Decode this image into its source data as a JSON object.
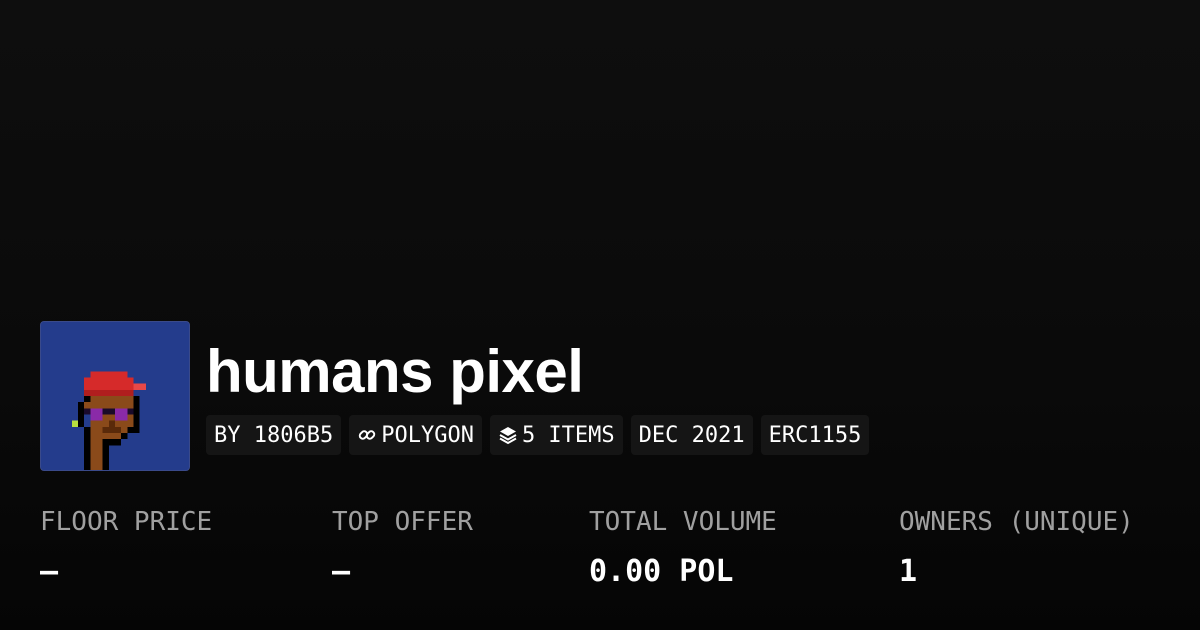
{
  "collection": {
    "name": "humans pixel",
    "avatar_alt": "humans pixel collection avatar",
    "badges": {
      "creator": "BY 1806B5",
      "chain": "POLYGON",
      "items": "5 ITEMS",
      "date": "DEC 2021",
      "standard": "ERC1155"
    }
  },
  "stats": {
    "floor_price": {
      "label": "FLOOR PRICE",
      "value": "–"
    },
    "top_offer": {
      "label": "TOP OFFER",
      "value": "–"
    },
    "total_volume": {
      "label": "TOTAL VOLUME",
      "value": "0.00 POL"
    },
    "owners": {
      "label": "OWNERS (UNIQUE)",
      "value": "1"
    }
  },
  "colors": {
    "background": "#0a0a0a",
    "badge_bg": "#151515",
    "label": "#a0a0a0",
    "avatar_bg": "#243c8c"
  },
  "icons": {
    "chain": "polygon-link-icon",
    "items": "layers-icon"
  }
}
